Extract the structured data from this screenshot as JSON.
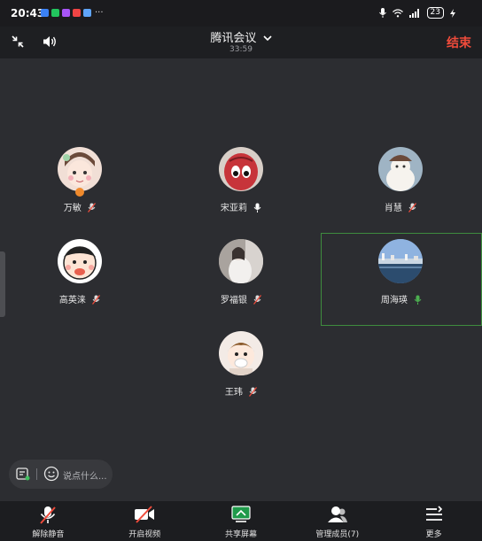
{
  "status_bar": {
    "time": "20:43",
    "overflow": "···",
    "battery": "23",
    "app_icon_colors": [
      "#3b82f6",
      "#22c55e",
      "#a855f7",
      "#ef4444",
      "#60a5fa"
    ]
  },
  "header": {
    "title": "腾讯会议",
    "duration": "33:59",
    "end_label": "结束"
  },
  "participants": [
    {
      "name": "万敏",
      "mic": "muted",
      "host": true,
      "avatar_colors": [
        "#f1dfd6",
        "#e6b7c1"
      ]
    },
    {
      "name": "宋亚莉",
      "mic": "on",
      "host": false,
      "avatar_colors": [
        "#d8cfc8",
        "#c7343a"
      ]
    },
    {
      "name": "肖慧",
      "mic": "muted",
      "host": false,
      "avatar_colors": [
        "#9fb4c4",
        "#f6f3ee"
      ]
    },
    {
      "name": "高英涞",
      "mic": "muted",
      "host": false,
      "avatar_colors": [
        "#ffffff",
        "#e85f4e"
      ]
    },
    {
      "name": "罗福银",
      "mic": "muted",
      "host": false,
      "avatar_colors": [
        "#bfb9b4",
        "#f2f0ee"
      ]
    },
    {
      "name": "周海瑛",
      "mic": "speaking",
      "host": false,
      "active": true,
      "avatar_colors": [
        "#7fa6d6",
        "#2c4c6e"
      ]
    },
    {
      "name": "王玮",
      "mic": "muted",
      "host": false,
      "avatar_colors": [
        "#f3ebe6",
        "#8a5a2b"
      ]
    }
  ],
  "chat": {
    "placeholder": "说点什么..."
  },
  "toolbar": [
    {
      "label": "解除静音",
      "icon": "mic-muted-icon"
    },
    {
      "label": "开启视频",
      "icon": "video-off-icon"
    },
    {
      "label": "共享屏幕",
      "icon": "share-screen-icon"
    },
    {
      "label": "管理成员(7)",
      "icon": "members-icon"
    },
    {
      "label": "更多",
      "icon": "more-icon"
    }
  ],
  "colors": {
    "accent_end": "#ef4b3b",
    "active_border": "#3e8c3e",
    "speaking_green": "#4caf50",
    "host_badge": "#f08a2c"
  }
}
